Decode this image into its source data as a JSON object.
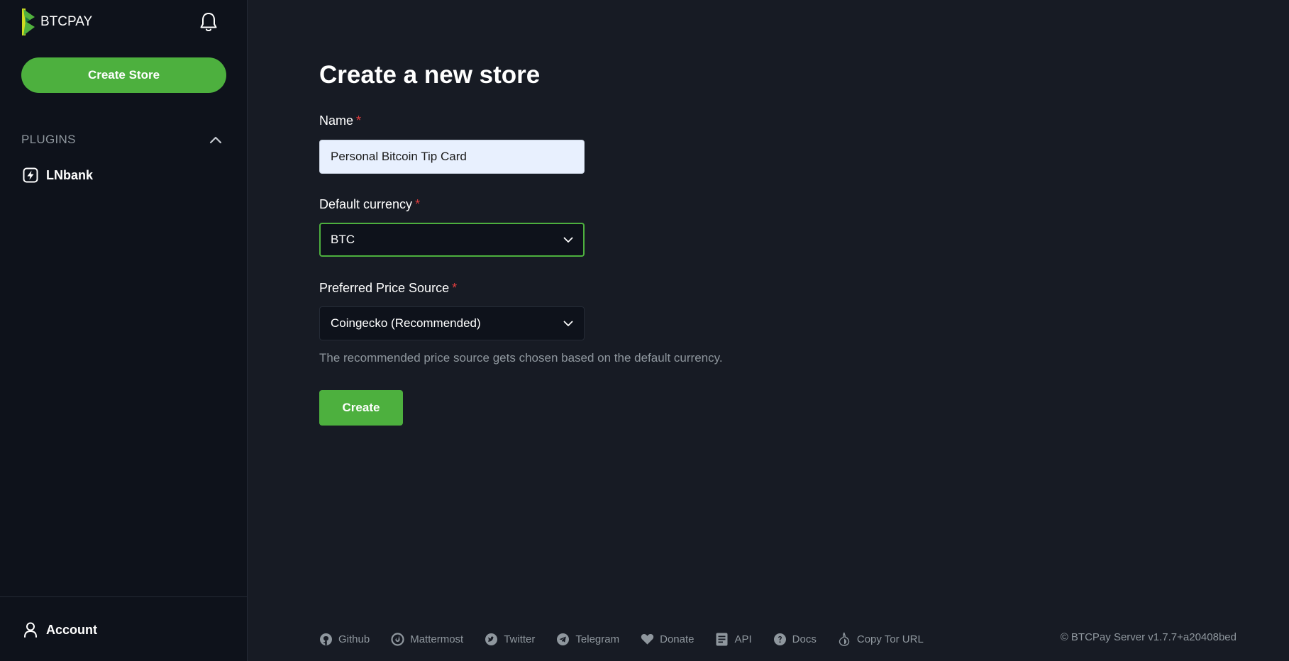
{
  "sidebar": {
    "logo_text": "BTCPAY",
    "create_store_label": "Create Store",
    "plugins_label": "PLUGINS",
    "plugins": [
      {
        "label": "LNbank",
        "icon": "lightning-icon"
      }
    ],
    "account_label": "Account"
  },
  "main": {
    "title": "Create a new store",
    "name_field": {
      "label": "Name",
      "required_mark": "*",
      "value": "Personal Bitcoin Tip Card"
    },
    "currency_field": {
      "label": "Default currency",
      "required_mark": "*",
      "selected": "BTC"
    },
    "price_source_field": {
      "label": "Preferred Price Source",
      "required_mark": "*",
      "selected": "Coingecko (Recommended)",
      "help": "The recommended price source gets chosen based on the default currency."
    },
    "create_label": "Create"
  },
  "footer": {
    "links": [
      {
        "label": "Github",
        "icon": "github-icon"
      },
      {
        "label": "Mattermost",
        "icon": "mattermost-icon"
      },
      {
        "label": "Twitter",
        "icon": "twitter-icon"
      },
      {
        "label": "Telegram",
        "icon": "telegram-icon"
      },
      {
        "label": "Donate",
        "icon": "heart-icon"
      },
      {
        "label": "API",
        "icon": "document-icon"
      },
      {
        "label": "Docs",
        "icon": "question-icon"
      },
      {
        "label": "Copy Tor URL",
        "icon": "tor-icon"
      }
    ],
    "copyright": "© BTCPay Server v1.7.7+a20408bed"
  },
  "colors": {
    "accent": "#4db03e",
    "sidebar_bg": "#0e121b",
    "main_bg": "#171b24",
    "muted_text": "#8f979e",
    "required": "#e03e3e"
  }
}
